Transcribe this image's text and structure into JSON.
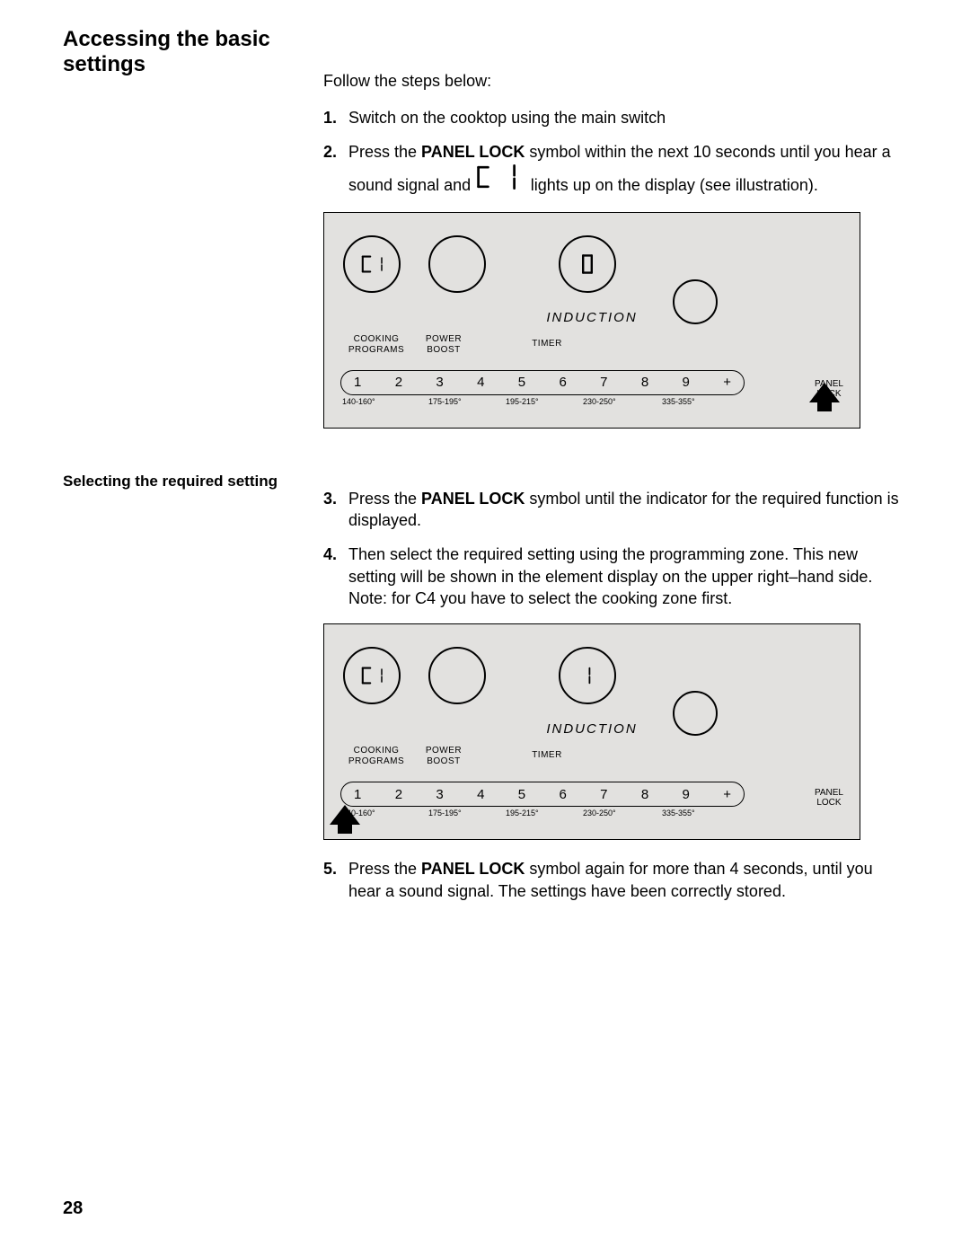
{
  "page_number": "28",
  "heading": "Accessing the basic settings",
  "intro": "Follow the steps below:",
  "sub_heading": "Selecting the required setting",
  "steps": {
    "s1": {
      "num": "1.",
      "text": "Switch on the cooktop using the main switch"
    },
    "s2": {
      "num": "2.",
      "pre": "Press the ",
      "bold": "PANEL LOCK",
      "mid": " symbol within the next 10 seconds until you hear a sound signal and ",
      "seg": "c 1",
      "post": " lights up on the display (see illustration)."
    },
    "s3": {
      "num": "3.",
      "pre": "Press the ",
      "bold": "PANEL LOCK",
      "post": " symbol until the indicator for the required function is displayed."
    },
    "s4": {
      "num": "4.",
      "text": "Then select the required setting using the programming zone. This new setting will be shown in the element display on the upper right–hand side.",
      "note": "Note: for C4 you have to select the cooking zone first."
    },
    "s5": {
      "num": "5.",
      "pre": "Press the ",
      "bold": "PANEL LOCK",
      "post": " symbol again for more than 4 seconds, until you hear a sound signal. The settings have been correctly stored."
    }
  },
  "panel": {
    "induction": "INDUCTION",
    "cooking_programs": "COOKING PROGRAMS",
    "power_boost": "POWER BOOST",
    "timer": "TIMER",
    "panel_lock": "PANEL LOCK",
    "scale": [
      "1",
      "2",
      "3",
      "4",
      "5",
      "6",
      "7",
      "8",
      "9",
      "+"
    ],
    "temps": [
      "140-160°",
      "175-195°",
      "195-215°",
      "230-250°",
      "335-355°"
    ],
    "disp1_left": "c 1",
    "disp1_right": "0",
    "disp2_left": "c 1",
    "disp2_right": "1"
  }
}
